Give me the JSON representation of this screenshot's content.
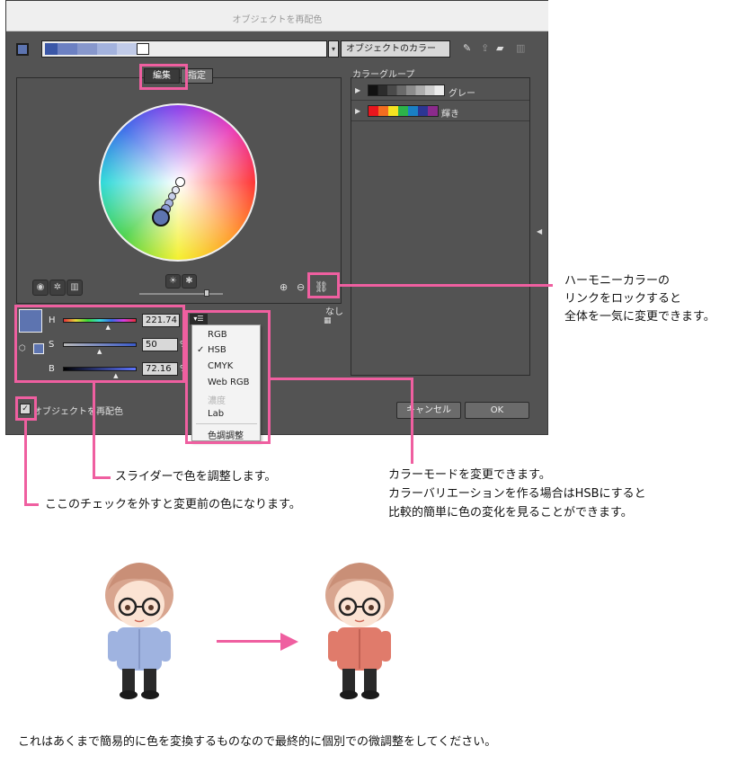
{
  "dialog": {
    "title": "オブジェクトを再配色",
    "current_colors_dropdown": "オブジェクトのカラー",
    "tabs": [
      "編集",
      "指定"
    ],
    "color_groups_header": "カラーグループ",
    "color_groups": [
      {
        "name": "グレー",
        "swatches": [
          "#111111",
          "#2c2c2c",
          "#4a4a4a",
          "#6a6a6a",
          "#8c8c8c",
          "#adadad",
          "#cdcdcd",
          "#ebebeb"
        ]
      },
      {
        "name": "輝き",
        "swatches": [
          "#e8161e",
          "#f36d20",
          "#f6e321",
          "#2cb34a",
          "#1a7fc4",
          "#2c3693",
          "#8b2a8c"
        ]
      }
    ],
    "colorbar_swatches": [
      "#3b57a7",
      "#6c80c2",
      "#8797cc",
      "#a3b2dd",
      "#c1cbe8",
      "#ffffff"
    ],
    "link_label": "なし",
    "sliders": [
      {
        "label": "H",
        "value": "221.74",
        "fraction": 0.616
      },
      {
        "label": "S",
        "value": "50",
        "fraction": 0.5
      },
      {
        "label": "B",
        "value": "72.16",
        "fraction": 0.7216
      }
    ],
    "percent_unit": "%",
    "mode_menu": {
      "items": [
        "RGB",
        "HSB",
        "CMYK",
        "Web RGB",
        "濃度",
        "Lab",
        "色調調整"
      ],
      "selected": "HSB",
      "disabled": [
        "濃度"
      ]
    },
    "recolor_checkbox_label": "オブジェクトを再配色",
    "recolor_checkbox_checked": true,
    "cancel_label": "キャンセル",
    "ok_label": "OK",
    "base_color": "#5d74b0"
  },
  "annotations": {
    "harmony_link": [
      "ハーモニーカラーの",
      "リンクをロックすると",
      "全体を一気に変更できます。"
    ],
    "sliders": "スライダーで色を調整します。",
    "checkbox": "ここのチェックを外すと変更前の色になります。",
    "color_mode": [
      "カラーモードを変更できます。",
      "カラーバリエーションを作る場合はHSBにすると",
      "比較的簡単に色の変化を見ることができます。"
    ],
    "accent_color": "#ef5fa0"
  },
  "illustration": {
    "before_shirt_color": "#9fb3e0",
    "after_shirt_color": "#e07b6b"
  },
  "footer_note": "これはあくまで簡易的に色を変換するものなので最終的に個別での微調整をしてください。"
}
